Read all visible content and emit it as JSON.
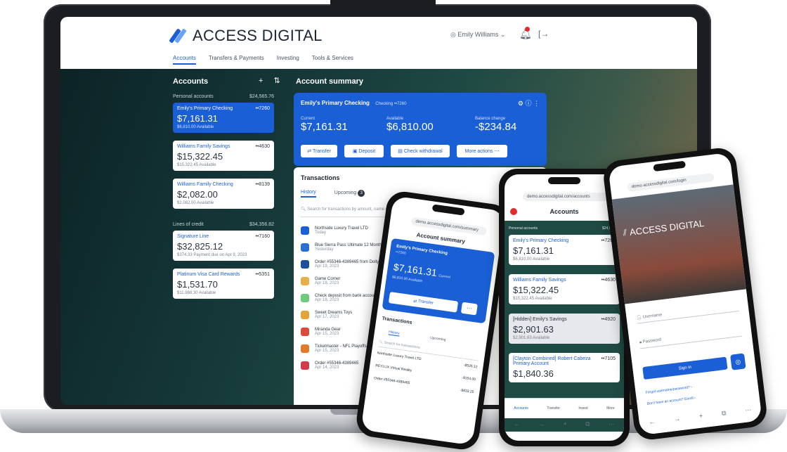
{
  "laptop": {
    "logo": "ACCESS DIGITAL",
    "user_menu": "Emily Williams",
    "nav": [
      "Accounts",
      "Transfers & Payments",
      "Investing",
      "Tools & Services"
    ],
    "accounts_title": "Accounts",
    "tool_icons": "+ ⇅",
    "deposit_section": {
      "label": "Personal accounts",
      "total": "$24,565.76"
    },
    "credit_section": {
      "label": "Lines of credit",
      "total": "$34,356.82"
    },
    "cards": [
      {
        "name": "Emily's Primary Checking",
        "mask": "••7260",
        "amount": "$7,161.31",
        "sub": "$6,810.00 Available"
      },
      {
        "name": "Williams Family Savings",
        "mask": "••4630",
        "amount": "$15,322.45",
        "sub": "$15,322.45 Available"
      },
      {
        "name": "Williams Family Checking",
        "mask": "••8139",
        "amount": "$2,082.00",
        "sub": "$2,082.00 Available"
      }
    ],
    "credit_cards": [
      {
        "name": "Signature Line",
        "mask": "••7160",
        "amount": "$32,825.12",
        "sub": "$374.33 Payment due on Apr 9, 2023"
      },
      {
        "name": "Platinum Visa Card Rewards",
        "mask": "••5351",
        "amount": "$1,531.70",
        "sub": "$11,968.30 Available"
      }
    ],
    "summary": {
      "title": "Account summary",
      "account_name": "Emily's Primary Checking",
      "account_mask": "Checking ••7260",
      "current_label": "Current",
      "current": "$7,161.31",
      "available_label": "Available",
      "available": "$6,810.00",
      "change_label": "Balance change",
      "change": "-$234.84",
      "buttons": [
        "Transfer",
        "Deposit",
        "Check withdrawal",
        "More actions"
      ]
    },
    "transactions": {
      "title": "Transactions",
      "tabs": [
        "History",
        "Upcoming"
      ],
      "upcoming_count": "3",
      "search_placeholder": "Search for transactions by amount, name or date",
      "rows": [
        {
          "name": "Northside Luxury Travel LTD",
          "date": "Today",
          "color": "#1a5fd6"
        },
        {
          "name": "Blue Sierra Pass Ultimate 12 Month Pass",
          "date": "Yesterday",
          "color": "#2a6fd6"
        },
        {
          "name": "Order #55346-4389465 from Dolly Trading",
          "date": "Apr 19, 2023",
          "color": "#1d4f9a"
        },
        {
          "name": "Game Corner",
          "date": "Apr 18, 2023",
          "color": "#e7b04b"
        },
        {
          "name": "Check deposit from bank account",
          "date": "Apr 18, 2023",
          "color": "#6bcd7a"
        },
        {
          "name": "Sweet Dreams Toys",
          "date": "Apr 17, 2023",
          "color": "#e3a43a"
        },
        {
          "name": "Miranda Gear",
          "date": "Apr 15, 2023",
          "color": "#d94b3b"
        },
        {
          "name": "Ticketmaster - NFL Playoffs",
          "date": "Apr 15, 2023",
          "color": "#e07b2b"
        },
        {
          "name": "Order #55346-4389465",
          "date": "Apr 14, 2023",
          "color": "#d23b4a"
        }
      ]
    }
  },
  "phone_left": {
    "url": "demo.accessdigital.com/summary",
    "title": "Account summary",
    "account_name": "Emily's Primary Checking",
    "account_mask": "••7260",
    "amount": "$7,161.31",
    "amount_label": "Current",
    "available": "$6,810.00 Available",
    "transfer": "Transfer",
    "tx_title": "Transactions",
    "tabs": [
      "History",
      "Upcoming"
    ],
    "search": "Search for transactions",
    "rows": [
      {
        "name": "Northside Luxury Travel LTD",
        "amount": "-$535.12"
      },
      {
        "name": "REYLUX Virtual Reality",
        "amount": "-$154.00"
      },
      {
        "name": "Order #55346-4389465",
        "amount": "-$833.25"
      }
    ]
  },
  "phone_mid": {
    "url": "demo.accessdigital.com/accounts",
    "title": "Accounts",
    "section": "Personal accounts",
    "section_total": "$24,565.76",
    "cards": [
      {
        "name": "Emily's Primary Checking",
        "mask": "••7260",
        "amount": "$7,161.31",
        "sub": "$6,810.00 Available"
      },
      {
        "name": "Williams Family Savings",
        "mask": "••4630",
        "amount": "$15,322.45",
        "sub": "$15,322.45 Available"
      },
      {
        "name": "[Hidden] Emily's Savings",
        "mask": "••4920",
        "amount": "$2,901.63",
        "sub": "$2,901.63 Available"
      },
      {
        "name": "[Clayton Combined] Robert Cabeza Primary Account",
        "mask": "••7105",
        "amount": "$1,840.36",
        "sub": ""
      }
    ],
    "tabbar": [
      "Accounts",
      "Transfer",
      "Invest",
      "More"
    ]
  },
  "phone_right": {
    "url": "demo.accessdigital.com/login",
    "logo": "ACCESS DIGITAL",
    "username": "Username",
    "password": "Password",
    "sign_in": "Sign in",
    "forgot": "Forgot username/password? ›",
    "no_account": "Don't have an account? Enroll ›"
  }
}
